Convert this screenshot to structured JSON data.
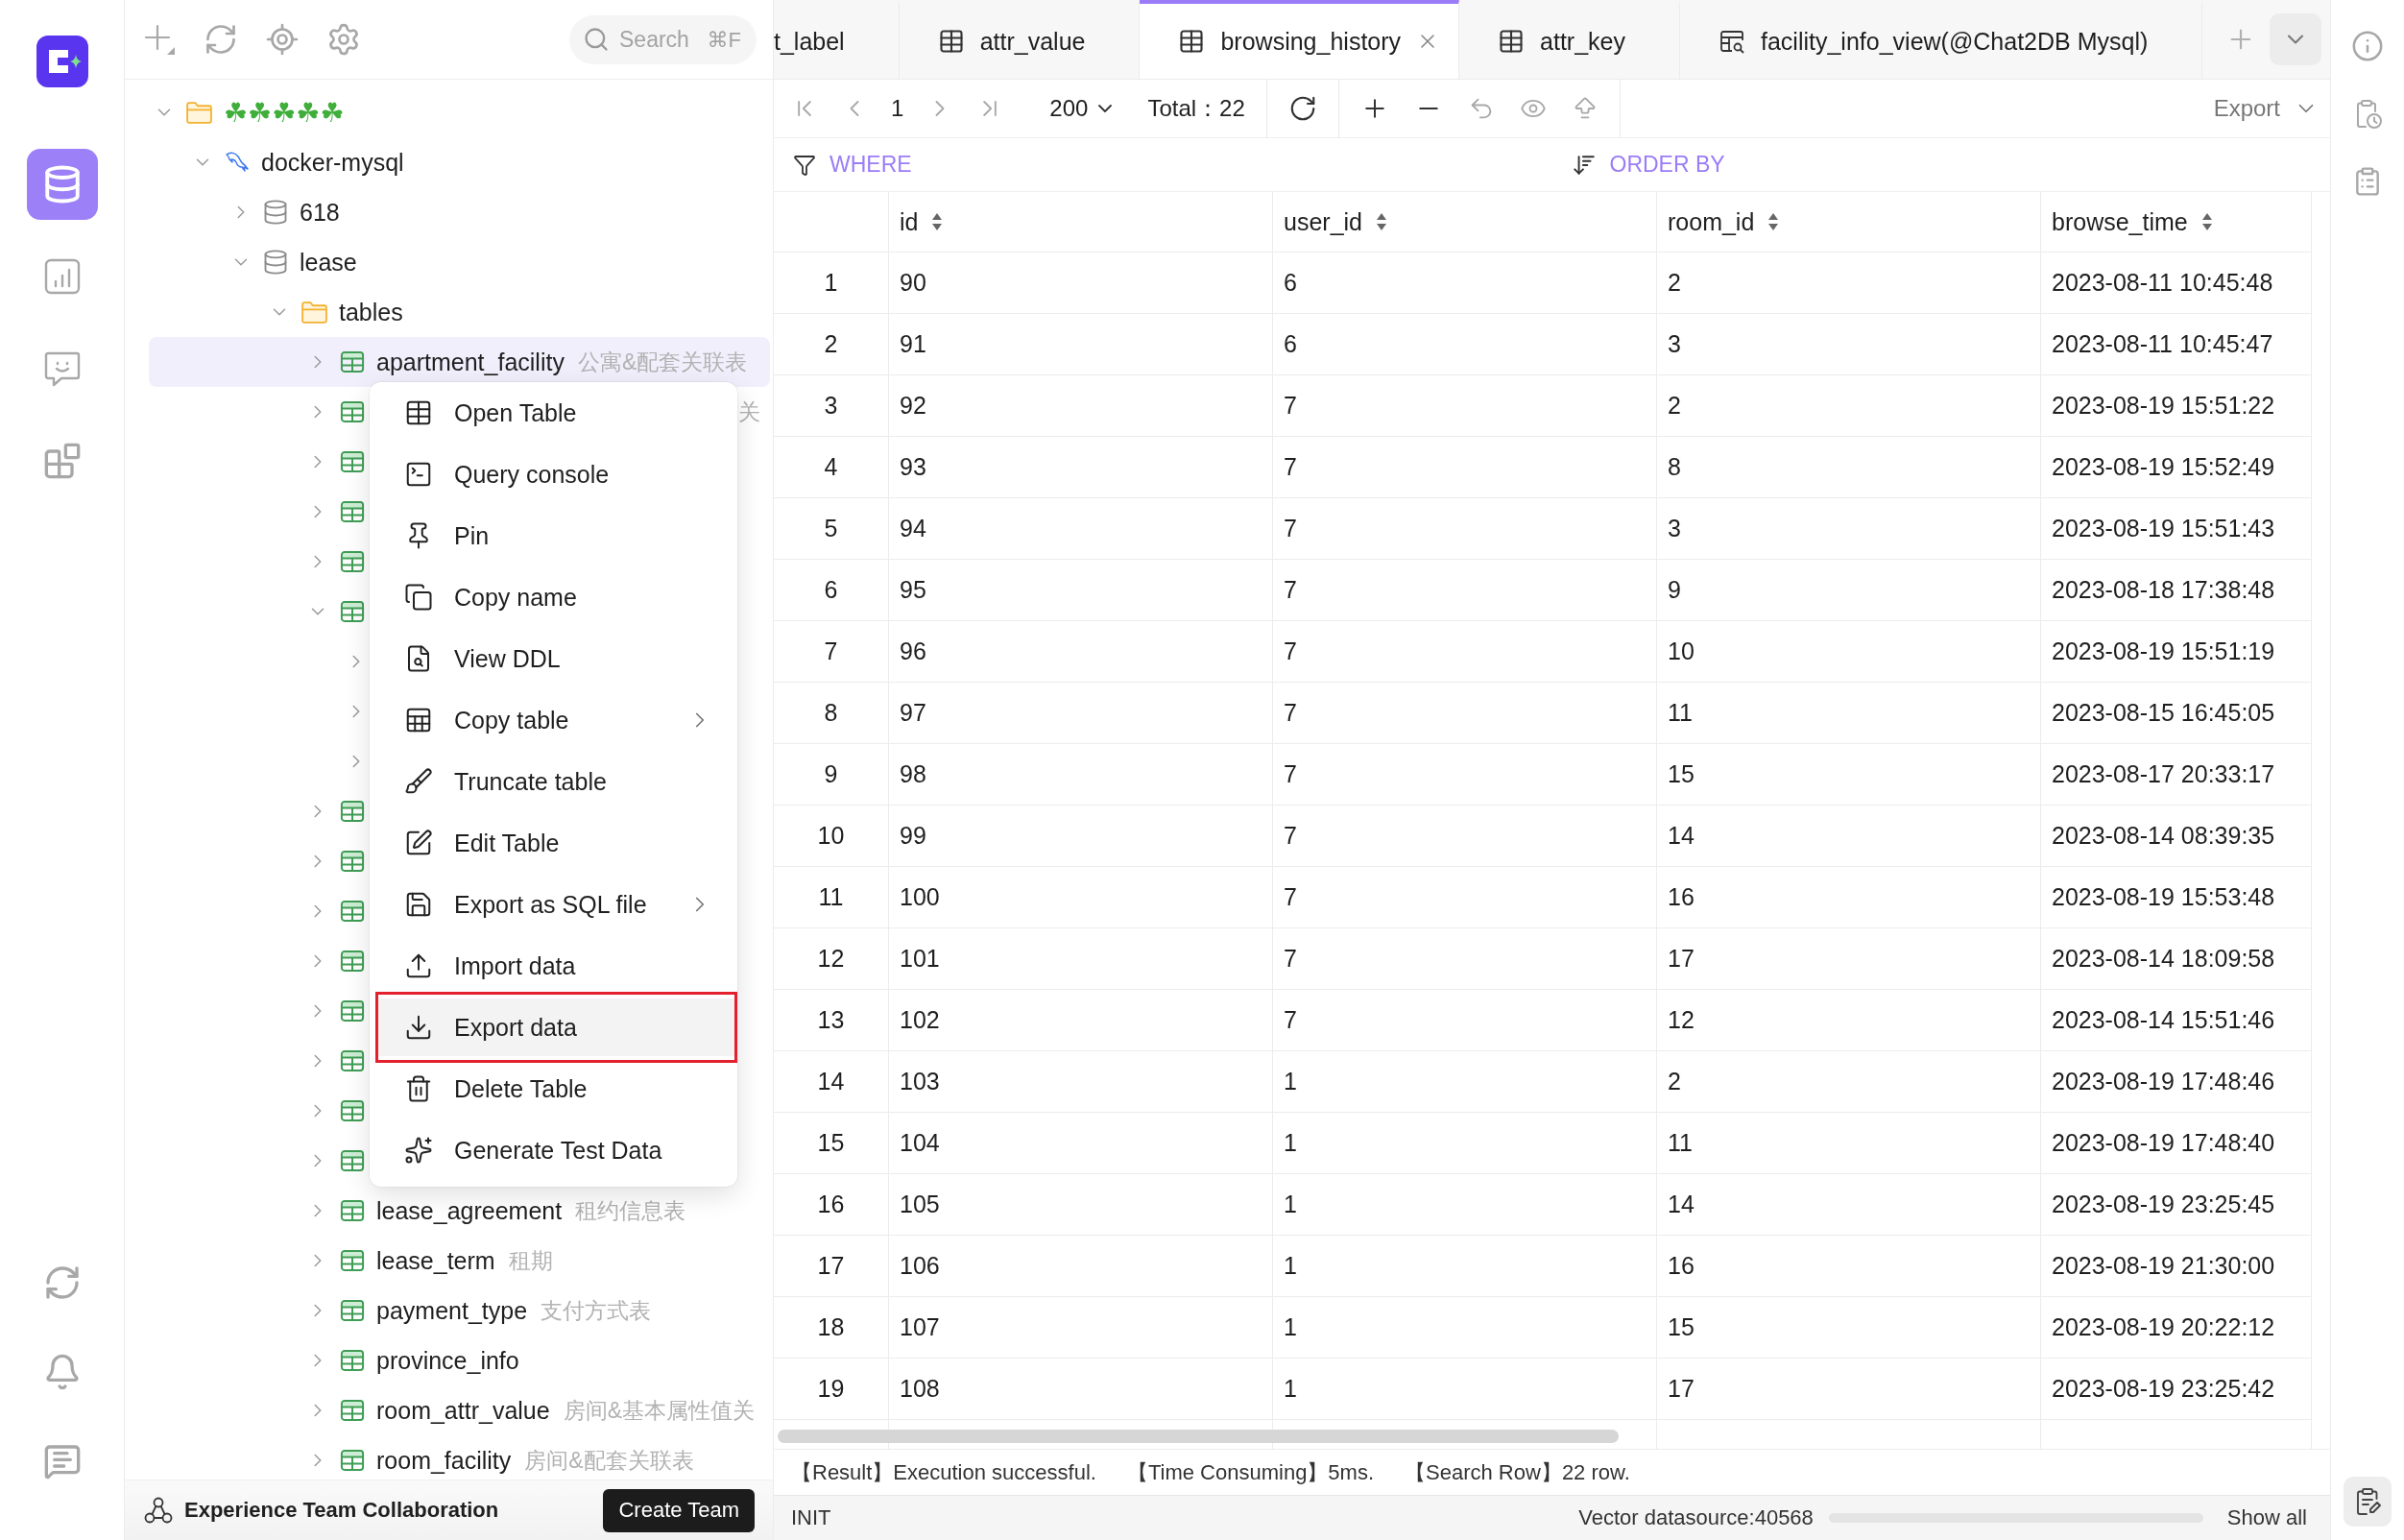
{
  "rail": {
    "items": [
      {
        "kind": "database",
        "selected": true
      },
      {
        "kind": "dashboard",
        "selected": false
      },
      {
        "kind": "chat",
        "selected": false
      },
      {
        "kind": "apps",
        "selected": false
      }
    ]
  },
  "sidebar": {
    "search": {
      "placeholder": "Search",
      "shortcut": "⌘F"
    },
    "tree": [
      {
        "kind": "folder",
        "label": "☘☘☘☘☘",
        "expanded": true,
        "selected": false,
        "children": [
          {
            "kind": "mysql",
            "label": "docker-mysql",
            "expanded": true,
            "selected": false,
            "children": [
              {
                "kind": "database",
                "label": "618",
                "expanded": false,
                "selected": false
              },
              {
                "kind": "database",
                "label": "lease",
                "expanded": true,
                "selected": false,
                "children": [
                  {
                    "kind": "folder",
                    "label": "tables",
                    "expanded": true,
                    "selected": false,
                    "children": [
                      {
                        "kind": "table",
                        "label": "apartment_facility",
                        "comment": "公寓&配套关联表",
                        "expanded": false,
                        "selected": true
                      },
                      {
                        "kind": "table",
                        "comment": "关",
                        "expanded": false,
                        "selected": false
                      },
                      {
                        "kind": "table",
                        "expanded": false,
                        "selected": false
                      },
                      {
                        "kind": "table",
                        "expanded": false,
                        "selected": false
                      },
                      {
                        "kind": "table",
                        "expanded": false,
                        "selected": false
                      },
                      {
                        "kind": "table",
                        "expanded": true,
                        "selected": false,
                        "children": [
                          {
                            "expanded": false,
                            "selected": false
                          },
                          {
                            "expanded": false,
                            "selected": false
                          },
                          {
                            "expanded": false,
                            "selected": false
                          }
                        ]
                      },
                      {
                        "kind": "table",
                        "expanded": false,
                        "selected": false
                      },
                      {
                        "kind": "table",
                        "expanded": false,
                        "selected": false
                      },
                      {
                        "kind": "table",
                        "expanded": false,
                        "selected": false
                      },
                      {
                        "kind": "table",
                        "expanded": false,
                        "selected": false
                      },
                      {
                        "kind": "table",
                        "expanded": false,
                        "selected": false
                      },
                      {
                        "kind": "table",
                        "expanded": false,
                        "selected": false
                      },
                      {
                        "kind": "table",
                        "expanded": false,
                        "selected": false
                      },
                      {
                        "kind": "table",
                        "expanded": false,
                        "selected": false
                      },
                      {
                        "kind": "table",
                        "label": "lease_agreement",
                        "comment": "租约信息表",
                        "expanded": false,
                        "selected": false
                      },
                      {
                        "kind": "table",
                        "label": "lease_term",
                        "comment": "租期",
                        "expanded": false,
                        "selected": false
                      },
                      {
                        "kind": "table",
                        "label": "payment_type",
                        "comment": "支付方式表",
                        "expanded": false,
                        "selected": false
                      },
                      {
                        "kind": "table",
                        "label": "province_info",
                        "expanded": false,
                        "selected": false
                      },
                      {
                        "kind": "table",
                        "label": "room_attr_value",
                        "comment": "房间&基本属性值关",
                        "expanded": false,
                        "selected": false
                      },
                      {
                        "kind": "table",
                        "label": "room_facility",
                        "comment": "房间&配套关联表",
                        "expanded": false,
                        "selected": false
                      }
                    ]
                  }
                ]
              }
            ]
          }
        ]
      }
    ],
    "footer": {
      "text": "Experience Team Collaboration",
      "button": "Create Team"
    }
  },
  "context_menu": {
    "items": [
      {
        "label": "Open Table",
        "submenu": false,
        "selected": false,
        "outlined": false
      },
      {
        "label": "Query console",
        "submenu": false,
        "selected": false,
        "outlined": false
      },
      {
        "label": "Pin",
        "submenu": false,
        "selected": false,
        "outlined": false
      },
      {
        "label": "Copy name",
        "submenu": false,
        "selected": false,
        "outlined": false
      },
      {
        "label": "View DDL",
        "submenu": false,
        "selected": false,
        "outlined": false
      },
      {
        "label": "Copy table",
        "submenu": true,
        "selected": false,
        "outlined": false
      },
      {
        "label": "Truncate table",
        "submenu": false,
        "selected": false,
        "outlined": false
      },
      {
        "label": "Edit Table",
        "submenu": false,
        "selected": false,
        "outlined": false
      },
      {
        "label": "Export as SQL file",
        "submenu": true,
        "selected": false,
        "outlined": false
      },
      {
        "label": "Import data",
        "submenu": false,
        "selected": false,
        "outlined": false
      },
      {
        "label": "Export data",
        "submenu": false,
        "selected": true,
        "outlined": true
      },
      {
        "label": "Delete Table",
        "submenu": false,
        "selected": false,
        "outlined": false
      },
      {
        "label": "Generate Test Data",
        "submenu": false,
        "selected": false,
        "outlined": false
      }
    ]
  },
  "tabs": [
    {
      "kind": "clipped",
      "label": "t_label",
      "selected": false
    },
    {
      "kind": "table",
      "label": "attr_value",
      "selected": false
    },
    {
      "kind": "table",
      "label": "browsing_history",
      "selected": true
    },
    {
      "kind": "table",
      "label": "attr_key",
      "selected": false
    },
    {
      "kind": "view",
      "label": "facility_info_view(@Chat2DB Mysql)",
      "selected": false
    }
  ],
  "toolbar": {
    "page": "1",
    "page_size": "200",
    "total": "Total：22",
    "export": "Export"
  },
  "filters": {
    "where": "WHERE",
    "order_by": "ORDER BY"
  },
  "table": {
    "columns": [
      "id",
      "user_id",
      "room_id",
      "browse_time"
    ],
    "rows": [
      {
        "index": "1",
        "cells": [
          "90",
          "6",
          "2",
          "2023-08-11 10:45:48"
        ]
      },
      {
        "index": "2",
        "cells": [
          "91",
          "6",
          "3",
          "2023-08-11 10:45:47"
        ]
      },
      {
        "index": "3",
        "cells": [
          "92",
          "7",
          "2",
          "2023-08-19 15:51:22"
        ]
      },
      {
        "index": "4",
        "cells": [
          "93",
          "7",
          "8",
          "2023-08-19 15:52:49"
        ]
      },
      {
        "index": "5",
        "cells": [
          "94",
          "7",
          "3",
          "2023-08-19 15:51:43"
        ]
      },
      {
        "index": "6",
        "cells": [
          "95",
          "7",
          "9",
          "2023-08-18 17:38:48"
        ]
      },
      {
        "index": "7",
        "cells": [
          "96",
          "7",
          "10",
          "2023-08-19 15:51:19"
        ]
      },
      {
        "index": "8",
        "cells": [
          "97",
          "7",
          "11",
          "2023-08-15 16:45:05"
        ]
      },
      {
        "index": "9",
        "cells": [
          "98",
          "7",
          "15",
          "2023-08-17 20:33:17"
        ]
      },
      {
        "index": "10",
        "cells": [
          "99",
          "7",
          "14",
          "2023-08-14 08:39:35"
        ]
      },
      {
        "index": "11",
        "cells": [
          "100",
          "7",
          "16",
          "2023-08-19 15:53:48"
        ]
      },
      {
        "index": "12",
        "cells": [
          "101",
          "7",
          "17",
          "2023-08-14 18:09:58"
        ]
      },
      {
        "index": "13",
        "cells": [
          "102",
          "7",
          "12",
          "2023-08-14 15:51:46"
        ]
      },
      {
        "index": "14",
        "cells": [
          "103",
          "1",
          "2",
          "2023-08-19 17:48:46"
        ]
      },
      {
        "index": "15",
        "cells": [
          "104",
          "1",
          "11",
          "2023-08-19 17:48:40"
        ]
      },
      {
        "index": "16",
        "cells": [
          "105",
          "1",
          "14",
          "2023-08-19 23:25:45"
        ]
      },
      {
        "index": "17",
        "cells": [
          "106",
          "1",
          "16",
          "2023-08-19 21:30:00"
        ]
      },
      {
        "index": "18",
        "cells": [
          "107",
          "1",
          "15",
          "2023-08-19 20:22:12"
        ]
      },
      {
        "index": "19",
        "cells": [
          "108",
          "1",
          "17",
          "2023-08-19 23:25:42"
        ]
      }
    ]
  },
  "result_bar": [
    "【Result】Execution successful.",
    "【Time Consuming】5ms.",
    "【Search Row】22 row."
  ],
  "status_bar": {
    "state": "INIT",
    "datasource": "Vector datasource:40568",
    "show_all": "Show all"
  }
}
